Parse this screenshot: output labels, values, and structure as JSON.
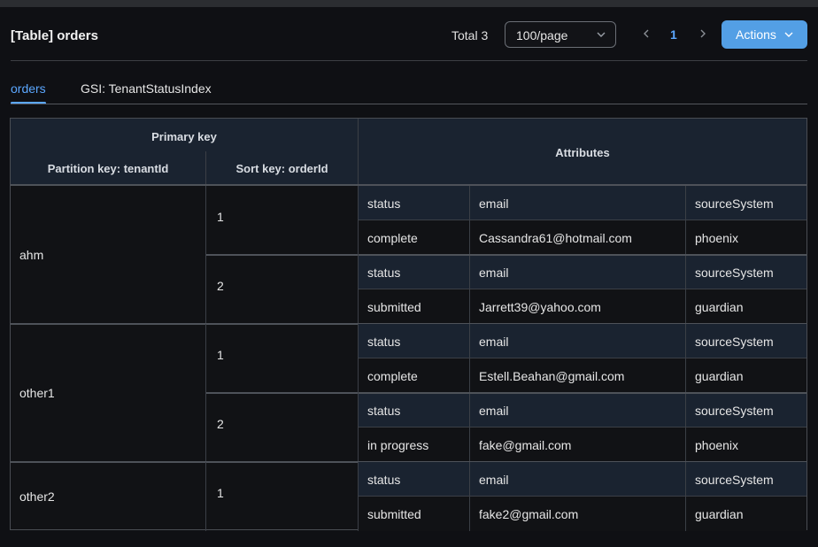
{
  "header": {
    "title": "[Table] orders",
    "total": "Total 3",
    "page_size": "100/page",
    "page_number": "1",
    "actions_label": "Actions"
  },
  "tabs": [
    {
      "label": "orders",
      "active": true
    },
    {
      "label": "GSI: TenantStatusIndex",
      "active": false
    }
  ],
  "table": {
    "primary_key_label": "Primary key",
    "partition_key_label": "Partition key: tenantId",
    "sort_key_label": "Sort key: orderId",
    "attributes_label": "Attributes",
    "attr_names": [
      "status",
      "email",
      "sourceSystem"
    ],
    "groups": [
      {
        "partition": "ahm",
        "items": [
          {
            "sort": "1",
            "values": [
              "complete",
              "Cassandra61@hotmail.com",
              "phoenix"
            ]
          },
          {
            "sort": "2",
            "values": [
              "submitted",
              "Jarrett39@yahoo.com",
              "guardian"
            ]
          }
        ]
      },
      {
        "partition": "other1",
        "items": [
          {
            "sort": "1",
            "values": [
              "complete",
              "Estell.Beahan@gmail.com",
              "guardian"
            ]
          },
          {
            "sort": "2",
            "values": [
              "in progress",
              "fake@gmail.com",
              "phoenix"
            ]
          }
        ]
      },
      {
        "partition": "other2",
        "items": [
          {
            "sort": "1",
            "values": [
              "submitted",
              "fake2@gmail.com",
              "guardian"
            ]
          }
        ]
      }
    ]
  },
  "colors": {
    "accent": "#539fe5",
    "link": "#5ba7ff",
    "background": "#0f1014",
    "header_row": "#1a2330"
  },
  "icons": {
    "page_size_chevron": "chevron-down-icon",
    "prev": "chevron-left-icon",
    "next": "chevron-right-icon",
    "actions_chevron": "chevron-down-icon"
  }
}
